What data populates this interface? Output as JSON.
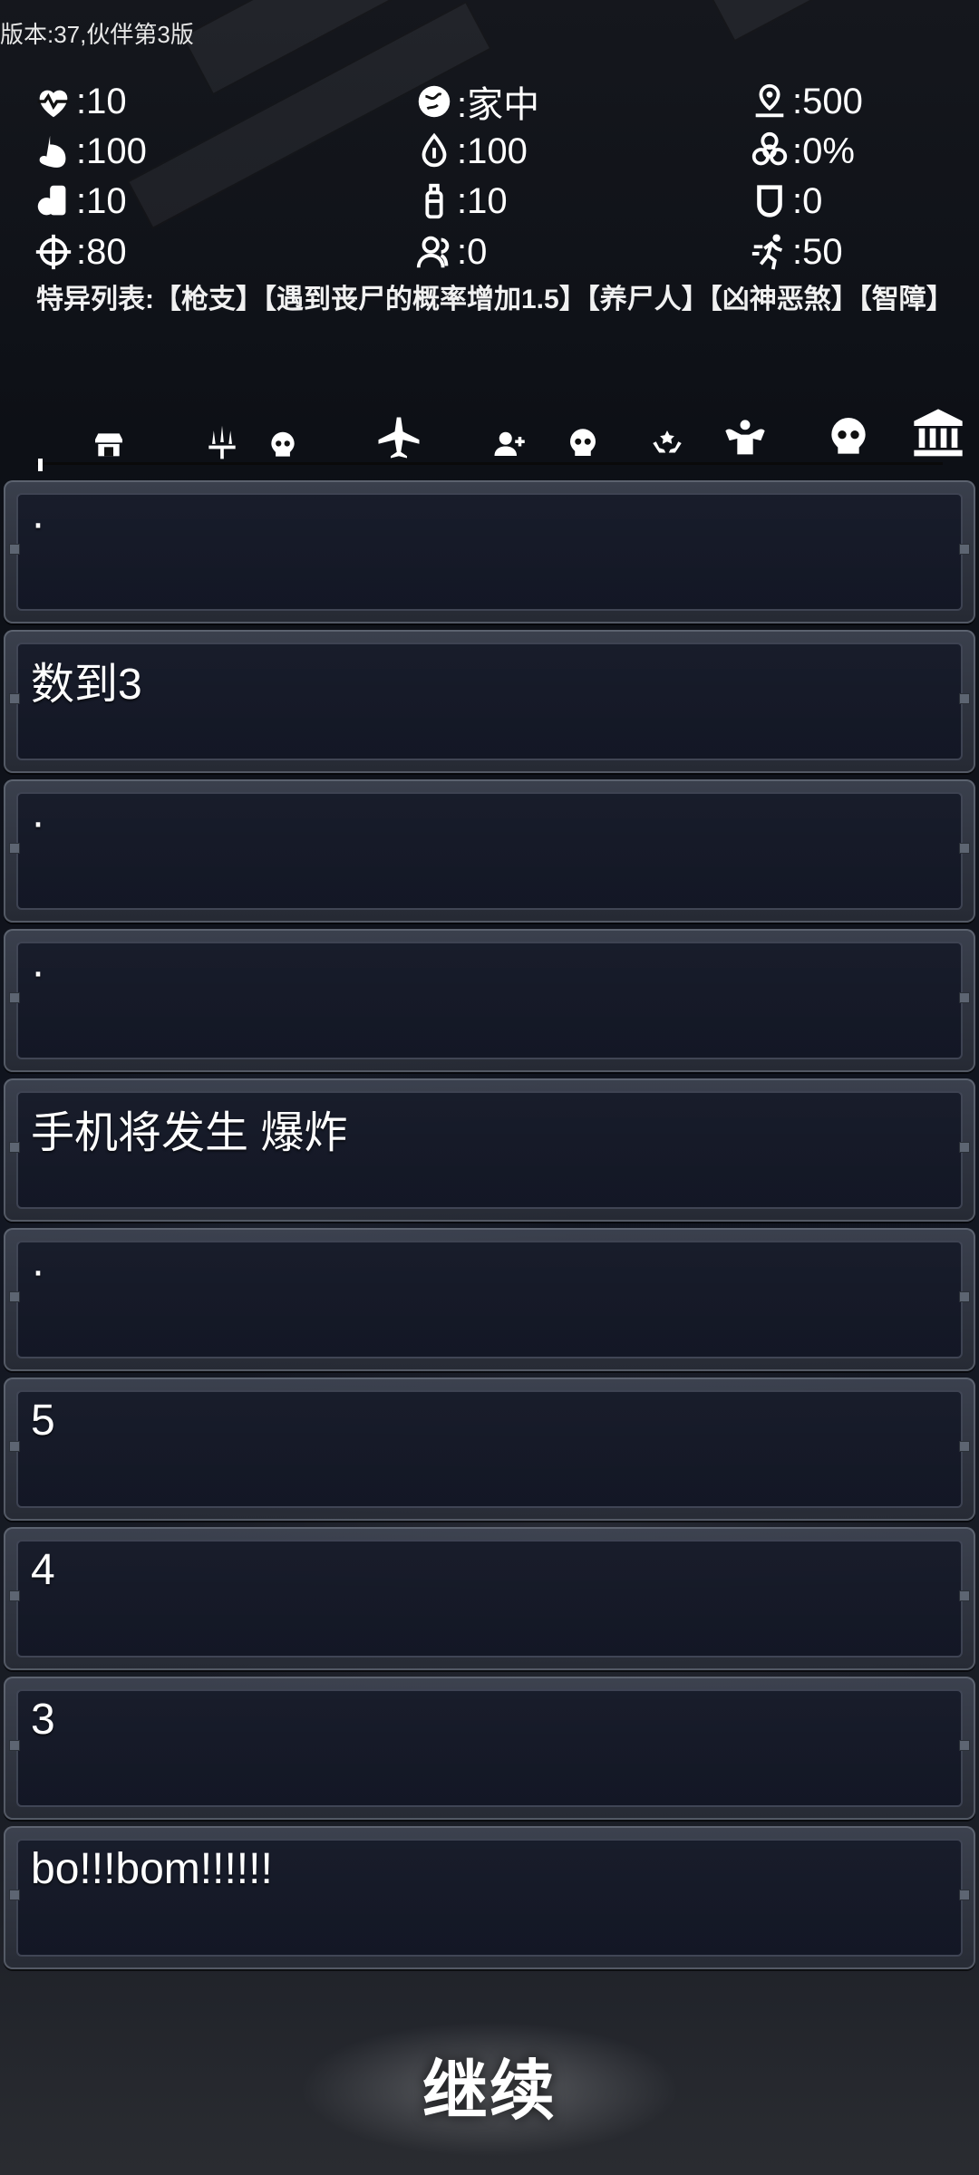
{
  "version_text": "版本:37,伙伴第3版",
  "stats": {
    "health": ":10",
    "location": ":家中",
    "distance": ":500",
    "hunger": ":100",
    "thirst": ":100",
    "infection": ":0%",
    "food": ":10",
    "water": ":10",
    "shield": ":0",
    "aim": ":80",
    "companions": ":0",
    "speed": ":50"
  },
  "traits_text": "特异列表:【枪支】【遇到丧尸的概率增加1.5】【养尸人】【凶神恶煞】【智障】",
  "toolbar": {
    "icons": [
      "shop-icon",
      "weapons-icon",
      "skull-icon",
      "airplane-icon",
      "add-user-icon",
      "skull-icon",
      "charity-hands-icon",
      "muscle-icon",
      "skull-icon",
      "bank-icon"
    ]
  },
  "messages": [
    "·",
    "数到3",
    "·",
    "·",
    "手机将发生 爆炸",
    "·",
    "5",
    "4",
    "3",
    "bo!!!bom!!!!!!"
  ],
  "continue_label": "继续"
}
